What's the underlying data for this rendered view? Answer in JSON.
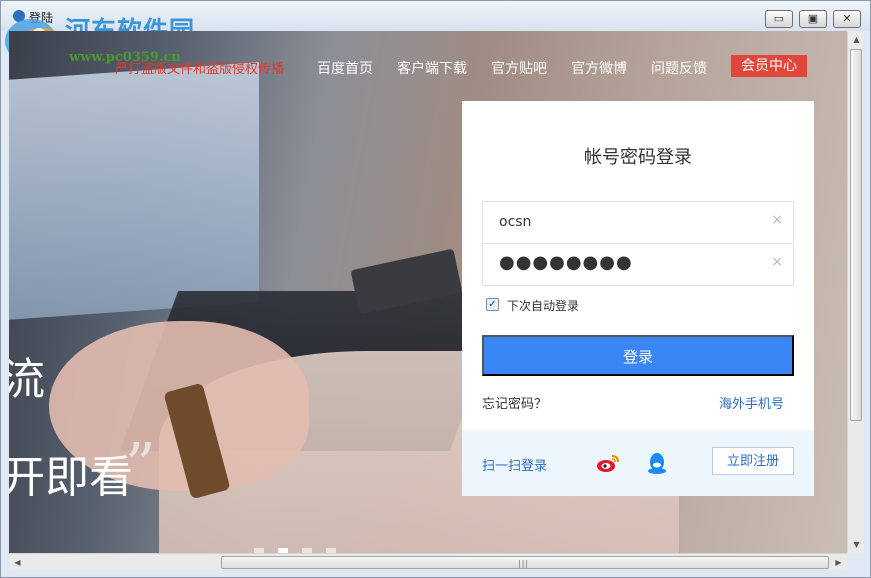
{
  "window": {
    "title": "登陆",
    "minimize_glyph": "▭",
    "maximize_glyph": "▣",
    "close_glyph": "✕"
  },
  "watermark": {
    "name": "河东软件园",
    "url": "www.pc0359.cn"
  },
  "nav": {
    "warning": "严打盗版文件和盗版侵权传播",
    "items": [
      {
        "label": "百度首页"
      },
      {
        "label": "客户端下载"
      },
      {
        "label": "官方贴吧"
      },
      {
        "label": "官方微博"
      },
      {
        "label": "问题反馈"
      }
    ],
    "member_center": "会员中心"
  },
  "hero": {
    "line1": "流",
    "line2": "开即看",
    "quote": "”"
  },
  "login": {
    "title": "帐号密码登录",
    "username_value": "ocsn",
    "password_mask": "●●●●●●●●",
    "clear_glyph": "×",
    "remember_label": "下次自动登录",
    "remember_checked_glyph": "✓",
    "login_button": "登录",
    "forgot_password": "忘记密码？",
    "overseas_phone": "海外手机号",
    "scan_login": "扫一扫登录",
    "register_button": "立即注册"
  },
  "icons": {
    "weibo": "weibo-icon",
    "qq": "qq-icon"
  },
  "colors": {
    "primary_blue": "#3b86f5",
    "link_blue": "#2d6bc7",
    "member_red": "#e0473a",
    "warning_red": "#e03b2a"
  },
  "scrollbars": {
    "up": "▲",
    "down": "▼",
    "left": "◀",
    "right": "▶",
    "grip": "|||"
  }
}
